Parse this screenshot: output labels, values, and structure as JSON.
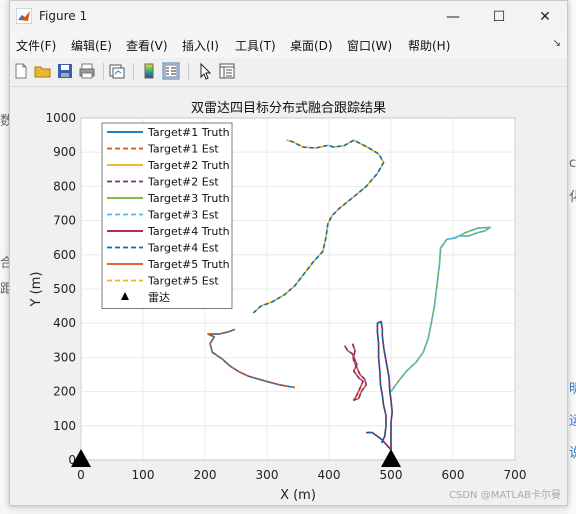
{
  "background": {
    "left_chars": [
      "数",
      "合",
      "距"
    ],
    "right_chars": [
      "c",
      "化"
    ],
    "right_blue_chars": [
      "明",
      "运",
      "说"
    ]
  },
  "window": {
    "title": "Figure 1",
    "controls": {
      "minimize": "—",
      "maximize": "☐",
      "close": "✕"
    }
  },
  "menu": {
    "items": [
      "文件(F)",
      "编辑(E)",
      "查看(V)",
      "插入(I)",
      "工具(T)",
      "桌面(D)",
      "窗口(W)",
      "帮助(H)"
    ],
    "overflow": "↘"
  },
  "toolbar": {
    "icons": [
      "new-figure-icon",
      "open-folder-icon",
      "save-icon",
      "print-icon",
      "link-plot-icon",
      "colorbar-icon",
      "legend-icon",
      "pointer-icon",
      "property-inspector-icon"
    ]
  },
  "chart_data": {
    "type": "line",
    "title": "双雷达四目标分布式融合跟踪结果",
    "xlabel": "X (m)",
    "ylabel": "Y (m)",
    "xlim": [
      0,
      700
    ],
    "ylim": [
      0,
      1000
    ],
    "xticks": [
      0,
      100,
      200,
      300,
      400,
      500,
      600,
      700
    ],
    "yticks": [
      0,
      100,
      200,
      300,
      400,
      500,
      600,
      700,
      800,
      900,
      1000
    ],
    "grid": true,
    "legend_position": "top-left",
    "legend": [
      {
        "label": "Target#1 Truth",
        "color": "#0072BD",
        "dash": false
      },
      {
        "label": "Target#1 Est",
        "color": "#D95319",
        "dash": true
      },
      {
        "label": "Target#2 Truth",
        "color": "#EDB120",
        "dash": false
      },
      {
        "label": "Target#2 Est",
        "color": "#7E2F8E",
        "dash": true
      },
      {
        "label": "Target#3 Truth",
        "color": "#77AC30",
        "dash": false
      },
      {
        "label": "Target#3 Est",
        "color": "#4DBEEE",
        "dash": true
      },
      {
        "label": "Target#4 Truth",
        "color": "#A2142F",
        "dash": false
      },
      {
        "label": "Target#4 Est",
        "color": "#0072BD",
        "dash": true
      },
      {
        "label": "Target#5 Truth",
        "color": "#D95319",
        "dash": false
      },
      {
        "label": "Target#5 Est",
        "color": "#EDB120",
        "dash": true
      },
      {
        "label": "雷达",
        "marker": "triangle",
        "color": "#000000"
      }
    ],
    "radars": [
      {
        "x": 0,
        "y": 0
      },
      {
        "x": 500,
        "y": 0
      }
    ],
    "series": [
      {
        "truth_color": "#77AC30",
        "est_color": "#4DBEEE",
        "points": [
          [
            500,
            200
          ],
          [
            512,
            230
          ],
          [
            525,
            260
          ],
          [
            540,
            285
          ],
          [
            552,
            315
          ],
          [
            560,
            355
          ],
          [
            565,
            400
          ],
          [
            570,
            450
          ],
          [
            574,
            510
          ],
          [
            578,
            570
          ],
          [
            580,
            620
          ],
          [
            590,
            645
          ],
          [
            605,
            650
          ],
          [
            620,
            665
          ],
          [
            640,
            678
          ],
          [
            660,
            680
          ],
          [
            652,
            670
          ],
          [
            640,
            665
          ],
          [
            625,
            655
          ],
          [
            610,
            655
          ],
          [
            598,
            647
          ]
        ]
      },
      {
        "truth_color": "#EDB120",
        "est_color": "#0072BD",
        "points": [
          [
            278,
            430
          ],
          [
            290,
            450
          ],
          [
            308,
            462
          ],
          [
            328,
            483
          ],
          [
            345,
            510
          ],
          [
            360,
            545
          ],
          [
            375,
            580
          ],
          [
            390,
            610
          ],
          [
            395,
            650
          ],
          [
            398,
            690
          ],
          [
            405,
            715
          ],
          [
            418,
            738
          ],
          [
            440,
            770
          ],
          [
            460,
            800
          ],
          [
            478,
            838
          ],
          [
            488,
            870
          ],
          [
            480,
            895
          ],
          [
            462,
            915
          ],
          [
            440,
            935
          ],
          [
            425,
            920
          ],
          [
            408,
            915
          ],
          [
            398,
            920
          ],
          [
            378,
            912
          ],
          [
            358,
            915
          ],
          [
            342,
            930
          ],
          [
            332,
            935
          ]
        ]
      },
      {
        "truth_color": "#0072BD",
        "est_color": "#D95319",
        "points": [
          [
            345,
            212
          ],
          [
            320,
            220
          ],
          [
            295,
            232
          ],
          [
            270,
            245
          ],
          [
            255,
            258
          ],
          [
            240,
            275
          ],
          [
            228,
            295
          ],
          [
            212,
            315
          ],
          [
            208,
            340
          ],
          [
            215,
            360
          ],
          [
            205,
            368
          ],
          [
            222,
            368
          ],
          [
            238,
            375
          ],
          [
            248,
            382
          ]
        ]
      },
      {
        "truth_color": "#A2142F",
        "est_color": "#0072BD",
        "points": [
          [
            485,
            50
          ],
          [
            490,
            70
          ],
          [
            492,
            100
          ],
          [
            492,
            130
          ],
          [
            488,
            160
          ],
          [
            486,
            190
          ],
          [
            483,
            220
          ],
          [
            482,
            260
          ],
          [
            480,
            300
          ],
          [
            480,
            340
          ],
          [
            478,
            375
          ],
          [
            478,
            400
          ],
          [
            484,
            405
          ],
          [
            486,
            385
          ],
          [
            486,
            365
          ],
          [
            488,
            330
          ],
          [
            491,
            300
          ],
          [
            494,
            270
          ],
          [
            497,
            240
          ],
          [
            498,
            200
          ],
          [
            500,
            175
          ],
          [
            502,
            140
          ],
          [
            500,
            110
          ],
          [
            500,
            80
          ],
          [
            500,
            50
          ],
          [
            500,
            30
          ],
          [
            495,
            40
          ],
          [
            485,
            60
          ],
          [
            470,
            80
          ],
          [
            460,
            80
          ]
        ]
      },
      {
        "truth_color": "#D95319",
        "est_color": "#7E2F8E",
        "points": [
          [
            438,
            340
          ],
          [
            442,
            320
          ],
          [
            440,
            300
          ],
          [
            445,
            280
          ],
          [
            440,
            260
          ],
          [
            448,
            240
          ],
          [
            455,
            230
          ],
          [
            450,
            210
          ],
          [
            445,
            190
          ],
          [
            440,
            175
          ],
          [
            448,
            180
          ],
          [
            452,
            200
          ],
          [
            460,
            220
          ],
          [
            458,
            235
          ],
          [
            450,
            250
          ],
          [
            445,
            270
          ],
          [
            440,
            290
          ],
          [
            438,
            310
          ],
          [
            430,
            320
          ],
          [
            425,
            335
          ]
        ]
      }
    ]
  },
  "watermark": "CSDN @MATLAB卡尔曼"
}
